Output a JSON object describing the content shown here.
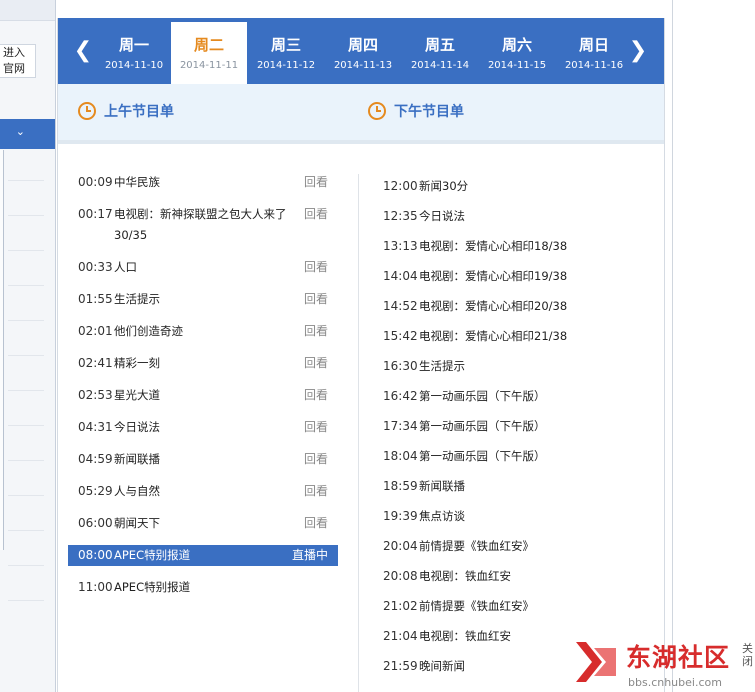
{
  "sidebar": {
    "link_text": "进入官网",
    "dropdown_icon": "chevron-down-icon"
  },
  "days": [
    {
      "name": "周一",
      "date": "2014-11-10",
      "active": false
    },
    {
      "name": "周二",
      "date": "2014-11-11",
      "active": true
    },
    {
      "name": "周三",
      "date": "2014-11-12",
      "active": false
    },
    {
      "name": "周四",
      "date": "2014-11-13",
      "active": false
    },
    {
      "name": "周五",
      "date": "2014-11-14",
      "active": false
    },
    {
      "name": "周六",
      "date": "2014-11-15",
      "active": false
    },
    {
      "name": "周日",
      "date": "2014-11-16",
      "active": false
    }
  ],
  "sections": {
    "morning": "上午节目单",
    "afternoon": "下午节目单"
  },
  "morning": [
    {
      "time": "00:09",
      "title": "中华民族",
      "action": "回看"
    },
    {
      "time": "00:17",
      "title": "电视剧：新神探联盟之包大人来了30/35",
      "action": "回看"
    },
    {
      "time": "00:33",
      "title": "人口",
      "action": "回看"
    },
    {
      "time": "01:55",
      "title": "生活提示",
      "action": "回看"
    },
    {
      "time": "02:01",
      "title": "他们创造奇迹",
      "action": "回看"
    },
    {
      "time": "02:41",
      "title": "精彩一刻",
      "action": "回看"
    },
    {
      "time": "02:53",
      "title": "星光大道",
      "action": "回看"
    },
    {
      "time": "04:31",
      "title": "今日说法",
      "action": "回看"
    },
    {
      "time": "04:59",
      "title": "新闻联播",
      "action": "回看"
    },
    {
      "time": "05:29",
      "title": "人与自然",
      "action": "回看"
    },
    {
      "time": "06:00",
      "title": "朝闻天下",
      "action": "回看"
    },
    {
      "time": "08:00",
      "title": "APEC特别报道",
      "action": "直播中",
      "live": true
    },
    {
      "time": "11:00",
      "title": "APEC特别报道",
      "action": ""
    }
  ],
  "afternoon": [
    {
      "time": "12:00",
      "title": "新闻30分"
    },
    {
      "time": "12:35",
      "title": "今日说法"
    },
    {
      "time": "13:13",
      "title": "电视剧：爱情心心相印18/38"
    },
    {
      "time": "14:04",
      "title": "电视剧：爱情心心相印19/38"
    },
    {
      "time": "14:52",
      "title": "电视剧：爱情心心相印20/38"
    },
    {
      "time": "15:42",
      "title": "电视剧：爱情心心相印21/38"
    },
    {
      "time": "16:30",
      "title": "生活提示"
    },
    {
      "time": "16:42",
      "title": "第一动画乐园（下午版）"
    },
    {
      "time": "17:34",
      "title": "第一动画乐园（下午版）"
    },
    {
      "time": "18:04",
      "title": "第一动画乐园（下午版）"
    },
    {
      "time": "18:59",
      "title": "新闻联播"
    },
    {
      "time": "19:39",
      "title": "焦点访谈"
    },
    {
      "time": "20:04",
      "title": "前情提要《铁血红安》"
    },
    {
      "time": "20:08",
      "title": "电视剧：铁血红安"
    },
    {
      "time": "21:02",
      "title": "前情提要《铁血红安》"
    },
    {
      "time": "21:04",
      "title": "电视剧：铁血红安"
    },
    {
      "time": "21:59",
      "title": "晚间新闻"
    }
  ],
  "watermark": {
    "brand": "东湖社区",
    "url": "bbs.cnhubei.com",
    "close_label": "关闭"
  },
  "colors": {
    "accent": "#3a6fc2",
    "active_day": "#e58a1f",
    "brand_red": "#d72c2c"
  }
}
